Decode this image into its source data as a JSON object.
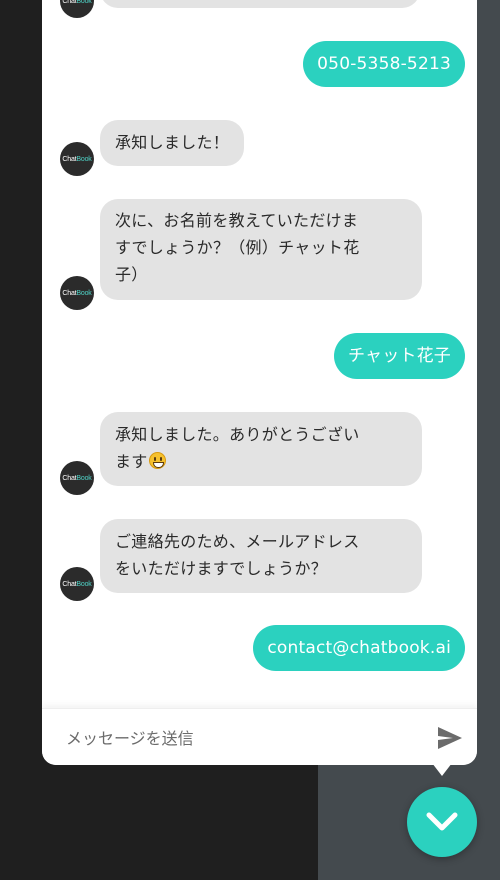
{
  "brand": {
    "avatar_text_1": "Chat",
    "avatar_text_2": "Book"
  },
  "colors": {
    "accent": "#2bd1bf",
    "bot_bubble": "#e3e3e3",
    "dark_bg": "#1f1f1f",
    "gray_bg": "#444a4e"
  },
  "messages": [
    {
      "from": "user",
      "text": "050-5358-5213"
    },
    {
      "from": "bot",
      "text": "承知しました！"
    },
    {
      "from": "bot",
      "line1": "次に、お名前を教えていただけま",
      "line2": "すでしょうか？（例）チャット花",
      "line3": "子）"
    },
    {
      "from": "user",
      "text": "チャット花子"
    },
    {
      "from": "bot",
      "line1": "承知しました。ありがとうござい",
      "line2": "ます",
      "emoji": "grinning-face"
    },
    {
      "from": "bot",
      "line1": "ご連絡先のため、メールアドレス",
      "line2": "をいただけますでしょうか？"
    },
    {
      "from": "user",
      "text": "contact@chatbook.ai"
    }
  ],
  "input": {
    "placeholder": "メッセージを送信",
    "value": ""
  },
  "icons": {
    "send": "send-icon",
    "toggle": "chevron-down-icon"
  }
}
